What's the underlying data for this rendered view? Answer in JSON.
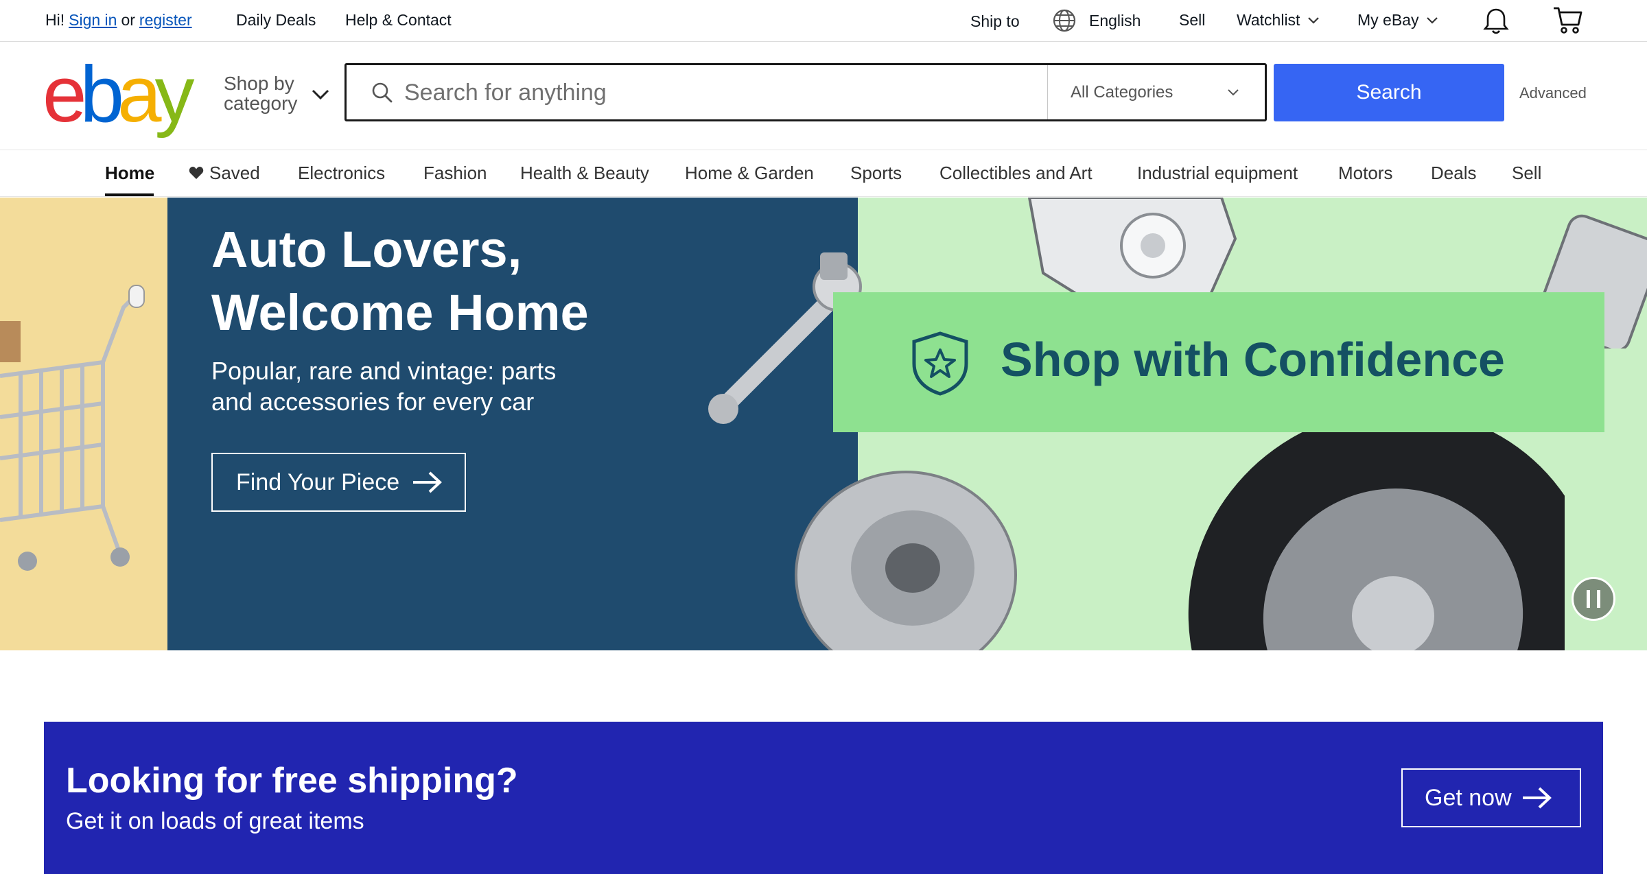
{
  "topbar": {
    "greeting": "Hi!",
    "sign_in": "Sign in",
    "or": "or",
    "register": "register",
    "daily_deals": "Daily Deals",
    "help_contact": "Help & Contact",
    "ship_to": "Ship to",
    "language": "English",
    "sell": "Sell",
    "watchlist": "Watchlist",
    "my_ebay": "My eBay"
  },
  "header": {
    "logo": [
      "e",
      "b",
      "a",
      "y"
    ],
    "shop_by_category": "Shop by category",
    "search": {
      "placeholder": "Search for anything",
      "value": ""
    },
    "category_select": "All Categories",
    "search_button": "Search",
    "advanced": "Advanced"
  },
  "nav": {
    "items": [
      "Home",
      "Saved",
      "Electronics",
      "Fashion",
      "Health & Beauty",
      "Home & Garden",
      "Sports",
      "Collectibles and Art",
      "Industrial equipment",
      "Motors",
      "Deals",
      "Sell"
    ],
    "active": "Home"
  },
  "hero": {
    "title": "Auto Lovers, Welcome Home",
    "subtitle": "Popular, rare and vintage: parts and accessories for every car",
    "cta": "Find Your Piece",
    "badge_text": "Shop with Confidence"
  },
  "promo": {
    "title": "Looking for free shipping?",
    "subtitle": "Get it on loads of great items",
    "cta": "Get now"
  },
  "colors": {
    "brand_blue": "#3665f3",
    "hero_dark": "#1f4b6e",
    "hero_green": "#8ee190",
    "promo_blue": "#2125b0",
    "link": "#0654ba"
  }
}
